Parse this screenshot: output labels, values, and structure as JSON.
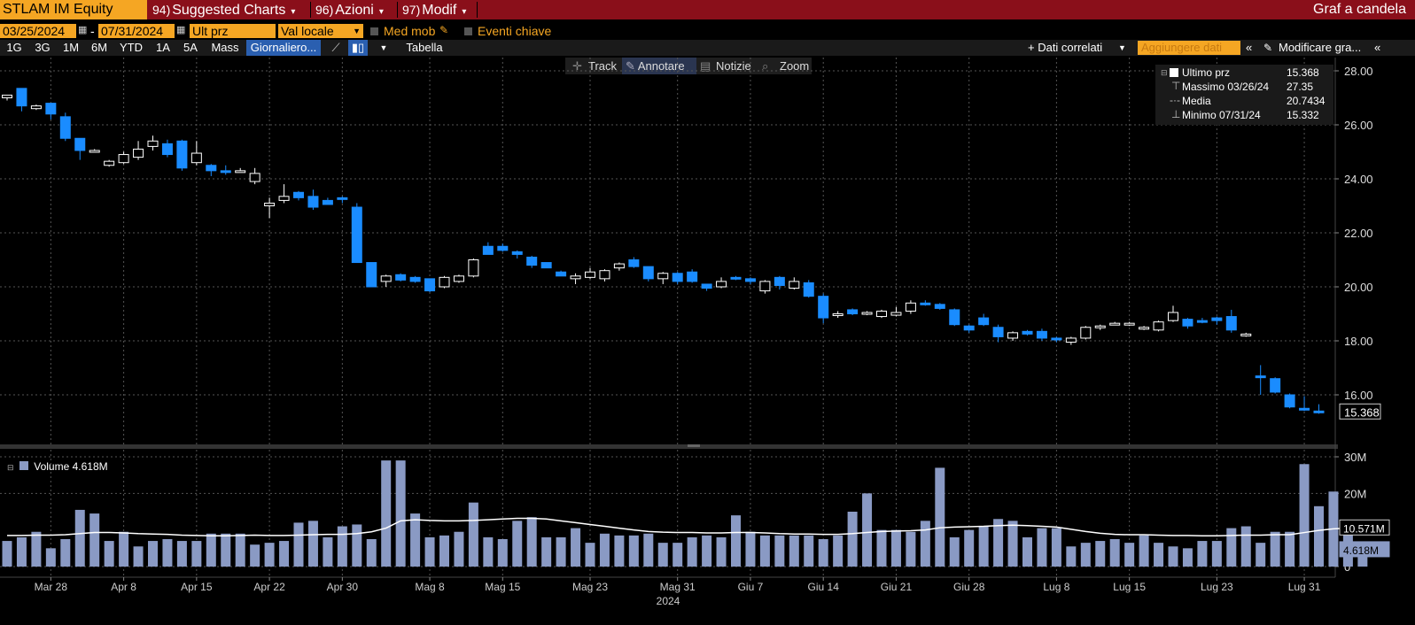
{
  "header": {
    "ticker": "STLAM IM Equity",
    "menus": [
      {
        "num": "94)",
        "label": "Suggested Charts"
      },
      {
        "num": "96)",
        "label": "Azioni"
      },
      {
        "num": "97)",
        "label": "Modif"
      }
    ],
    "chart_title": "Graf a candela"
  },
  "controls": {
    "start_date": "03/25/2024",
    "date_sep": "-",
    "end_date": "07/31/2024",
    "field": "Ult prz",
    "currency": "Val locale",
    "moving_avg": "Med mob",
    "key_events": "Eventi chiave"
  },
  "periods": [
    "1G",
    "3G",
    "1M",
    "6M",
    "YTD",
    "1A",
    "5A",
    "Mass"
  ],
  "frequency": "Giornaliero...",
  "table_label": "Tabella",
  "related_data": "+ Dati correlati",
  "add_data": "Aggiungere dati",
  "edit_chart": "Modificare gra...",
  "chart_tools": [
    "Track",
    "Annotare",
    "Notizie",
    "Zoom"
  ],
  "legend": {
    "last_label": "Ultimo prz",
    "last_value": "15.368",
    "high_label": "Massimo 03/26/24",
    "high_value": "27.35",
    "avg_label": "Media",
    "avg_value": "20.7434",
    "low_label": "Minimo 07/31/24",
    "low_value": "15.332"
  },
  "volume_legend": "Volume 4.618M",
  "colors": {
    "up": "#000000",
    "down": "#1a8cff",
    "volume": "#8a9ac4",
    "accent": "#f5a623",
    "header": "#8a0f1a"
  },
  "chart_data": [
    {
      "type": "candlestick",
      "ylim": [
        14,
        28.5
      ],
      "yticks": [
        "28.00",
        "26.00",
        "24.00",
        "22.00",
        "20.00",
        "18.00",
        "16.00"
      ],
      "last_price_label": "15.368",
      "x_labels": [
        "Mar 28",
        "Apr 8",
        "Apr 15",
        "Apr 22",
        "Apr 30",
        "Mag 8",
        "Mag 15",
        "Mag 23",
        "Mag 31",
        "Giu 7",
        "Giu 14",
        "Giu 21",
        "Giu 28",
        "Lug 8",
        "Lug 15",
        "Lug 23",
        "Lug 31"
      ],
      "x_label_index": [
        3,
        8,
        13,
        18,
        23,
        29,
        34,
        40,
        46,
        51,
        56,
        61,
        66,
        72,
        77,
        83,
        89
      ],
      "year_label": "2024",
      "candles": [
        [
          27.0,
          27.1,
          26.9,
          27.1
        ],
        [
          27.35,
          27.35,
          26.5,
          26.7
        ],
        [
          26.6,
          26.75,
          26.55,
          26.7
        ],
        [
          26.8,
          26.8,
          26.2,
          26.4
        ],
        [
          26.3,
          26.45,
          25.4,
          25.5
        ],
        [
          25.5,
          25.5,
          24.7,
          25.05
        ],
        [
          25.05,
          25.1,
          25.0,
          25.05
        ],
        [
          24.5,
          24.7,
          24.45,
          24.65
        ],
        [
          24.6,
          25.0,
          24.55,
          24.9
        ],
        [
          24.8,
          25.4,
          24.7,
          25.1
        ],
        [
          25.2,
          25.6,
          25.05,
          25.4
        ],
        [
          25.3,
          25.45,
          24.8,
          24.9
        ],
        [
          25.4,
          25.45,
          24.3,
          24.4
        ],
        [
          24.6,
          25.4,
          24.5,
          24.95
        ],
        [
          24.5,
          24.55,
          24.1,
          24.3
        ],
        [
          24.3,
          24.5,
          24.15,
          24.25
        ],
        [
          24.3,
          24.4,
          24.25,
          24.3
        ],
        [
          23.9,
          24.4,
          23.8,
          24.2
        ],
        [
          23.0,
          23.3,
          22.55,
          23.1
        ],
        [
          23.2,
          23.8,
          23.1,
          23.35
        ],
        [
          23.5,
          23.55,
          23.2,
          23.3
        ],
        [
          23.35,
          23.6,
          22.85,
          22.95
        ],
        [
          23.2,
          23.3,
          23.05,
          23.05
        ],
        [
          23.3,
          23.35,
          23.1,
          23.25
        ],
        [
          22.95,
          23.1,
          20.9,
          20.9
        ],
        [
          20.9,
          20.9,
          20.0,
          20.0
        ],
        [
          20.2,
          20.45,
          20.0,
          20.4
        ],
        [
          20.45,
          20.5,
          20.2,
          20.25
        ],
        [
          20.35,
          20.4,
          20.15,
          20.2
        ],
        [
          20.3,
          20.3,
          19.8,
          19.85
        ],
        [
          20.0,
          20.4,
          19.95,
          20.35
        ],
        [
          20.2,
          20.45,
          20.15,
          20.4
        ],
        [
          20.4,
          21.05,
          20.35,
          21.0
        ],
        [
          21.5,
          21.65,
          21.2,
          21.2
        ],
        [
          21.5,
          21.6,
          21.3,
          21.35
        ],
        [
          21.3,
          21.35,
          21.05,
          21.2
        ],
        [
          21.1,
          21.15,
          20.7,
          20.8
        ],
        [
          20.9,
          20.9,
          20.7,
          20.7
        ],
        [
          20.55,
          20.6,
          20.4,
          20.4
        ],
        [
          20.3,
          20.5,
          20.1,
          20.4
        ],
        [
          20.35,
          20.7,
          20.3,
          20.55
        ],
        [
          20.3,
          20.65,
          20.2,
          20.6
        ],
        [
          20.7,
          20.9,
          20.6,
          20.85
        ],
        [
          21.0,
          21.1,
          20.7,
          20.75
        ],
        [
          20.75,
          20.75,
          20.2,
          20.3
        ],
        [
          20.3,
          20.55,
          20.1,
          20.5
        ],
        [
          20.5,
          20.55,
          20.1,
          20.2
        ],
        [
          20.55,
          20.65,
          20.15,
          20.2
        ],
        [
          20.1,
          20.1,
          19.85,
          19.95
        ],
        [
          20.0,
          20.35,
          19.95,
          20.2
        ],
        [
          20.35,
          20.4,
          20.25,
          20.3
        ],
        [
          20.3,
          20.35,
          20.1,
          20.2
        ],
        [
          19.85,
          20.25,
          19.75,
          20.2
        ],
        [
          20.35,
          20.4,
          19.9,
          20.05
        ],
        [
          19.95,
          20.35,
          19.9,
          20.2
        ],
        [
          20.15,
          20.25,
          19.6,
          19.65
        ],
        [
          19.65,
          19.75,
          18.65,
          18.85
        ],
        [
          19.0,
          19.1,
          18.85,
          19.0
        ],
        [
          19.15,
          19.2,
          18.95,
          19.0
        ],
        [
          19.05,
          19.1,
          18.95,
          19.05
        ],
        [
          18.9,
          19.15,
          18.85,
          19.1
        ],
        [
          18.95,
          19.25,
          18.9,
          19.05
        ],
        [
          19.1,
          19.5,
          19.0,
          19.4
        ],
        [
          19.4,
          19.5,
          19.3,
          19.35
        ],
        [
          19.35,
          19.4,
          19.15,
          19.2
        ],
        [
          19.15,
          19.2,
          18.55,
          18.6
        ],
        [
          18.55,
          18.6,
          18.3,
          18.4
        ],
        [
          18.85,
          19.0,
          18.55,
          18.6
        ],
        [
          18.5,
          18.6,
          17.95,
          18.15
        ],
        [
          18.1,
          18.35,
          18.0,
          18.3
        ],
        [
          18.35,
          18.4,
          18.2,
          18.25
        ],
        [
          18.35,
          18.45,
          18.0,
          18.1
        ],
        [
          18.1,
          18.15,
          17.95,
          18.05
        ],
        [
          17.95,
          18.15,
          17.85,
          18.1
        ],
        [
          18.1,
          18.55,
          18.05,
          18.5
        ],
        [
          18.5,
          18.6,
          18.4,
          18.55
        ],
        [
          18.65,
          18.7,
          18.6,
          18.65
        ],
        [
          18.6,
          18.7,
          18.55,
          18.65
        ],
        [
          18.45,
          18.55,
          18.4,
          18.5
        ],
        [
          18.4,
          18.75,
          18.35,
          18.7
        ],
        [
          18.75,
          19.3,
          18.7,
          19.05
        ],
        [
          18.8,
          18.85,
          18.45,
          18.55
        ],
        [
          18.75,
          18.85,
          18.65,
          18.7
        ],
        [
          18.85,
          18.9,
          18.6,
          18.75
        ],
        [
          18.9,
          19.15,
          18.3,
          18.4
        ],
        [
          18.2,
          18.3,
          18.15,
          18.25
        ],
        [
          16.7,
          17.1,
          16.0,
          16.65
        ],
        [
          16.6,
          16.65,
          16.05,
          16.1
        ],
        [
          16.0,
          16.05,
          15.5,
          15.55
        ],
        [
          15.5,
          15.95,
          15.4,
          15.45
        ],
        [
          15.4,
          15.65,
          15.3,
          15.37
        ]
      ]
    },
    {
      "type": "bar",
      "title": "Volume",
      "ylim": [
        0,
        31
      ],
      "yticks": [
        "30M",
        "20M",
        "0"
      ],
      "labels": [
        "10.571M",
        "4.618M"
      ],
      "values": [
        7,
        8,
        9.5,
        5,
        7.5,
        15.5,
        14.5,
        7,
        9.5,
        5.5,
        7,
        7.5,
        7,
        7,
        9,
        9,
        9,
        6,
        6.5,
        7,
        12,
        12.5,
        8,
        11,
        11.5,
        7.5,
        29,
        29,
        14.5,
        8,
        8.5,
        9.5,
        17.5,
        8,
        7.5,
        12.5,
        13.5,
        8,
        8,
        10.5,
        6.5,
        9,
        8.5,
        8.5,
        9,
        6.5,
        6.5,
        8,
        8.5,
        8,
        14,
        9.5,
        8.5,
        8.5,
        8.5,
        8.5,
        7.5,
        8.5,
        15,
        20,
        10,
        10,
        9.5,
        12.5,
        27,
        8,
        10,
        11,
        13,
        12.5,
        8,
        10.5,
        10.5,
        5.5,
        6.5,
        7,
        7.5,
        6.5,
        8.5,
        6.5,
        5.5,
        5,
        7,
        7,
        10.5,
        11,
        6.5,
        9.5,
        9.5,
        28,
        16.5,
        20.5,
        12.5,
        4.6
      ],
      "ma_values": [
        8.5,
        8.5,
        8.6,
        8.6,
        8.7,
        9.0,
        9.3,
        9.3,
        9.2,
        9.0,
        8.9,
        8.8,
        8.6,
        8.5,
        8.4,
        8.4,
        8.5,
        8.6,
        8.5,
        8.5,
        8.6,
        8.7,
        8.8,
        8.8,
        9.0,
        9.5,
        10.5,
        12.5,
        12.8,
        12.6,
        12.5,
        12.5,
        12.6,
        12.8,
        13.0,
        13.2,
        13.2,
        13.0,
        12.5,
        12.0,
        11.5,
        11.0,
        10.5,
        10.0,
        9.6,
        9.4,
        9.3,
        9.3,
        9.2,
        9.2,
        9.3,
        9.3,
        9.2,
        9.0,
        8.9,
        8.9,
        8.8,
        8.8,
        9.0,
        9.3,
        9.6,
        9.7,
        9.8,
        10.0,
        10.6,
        10.8,
        10.9,
        11.0,
        11.2,
        11.3,
        11.2,
        11.0,
        10.8,
        10.2,
        9.6,
        9.1,
        8.8,
        8.7,
        8.7,
        8.6,
        8.5,
        8.5,
        8.4,
        8.4,
        8.5,
        8.6,
        8.6,
        8.7,
        8.7,
        9.3,
        9.9,
        10.3,
        10.5,
        10.57
      ]
    }
  ]
}
